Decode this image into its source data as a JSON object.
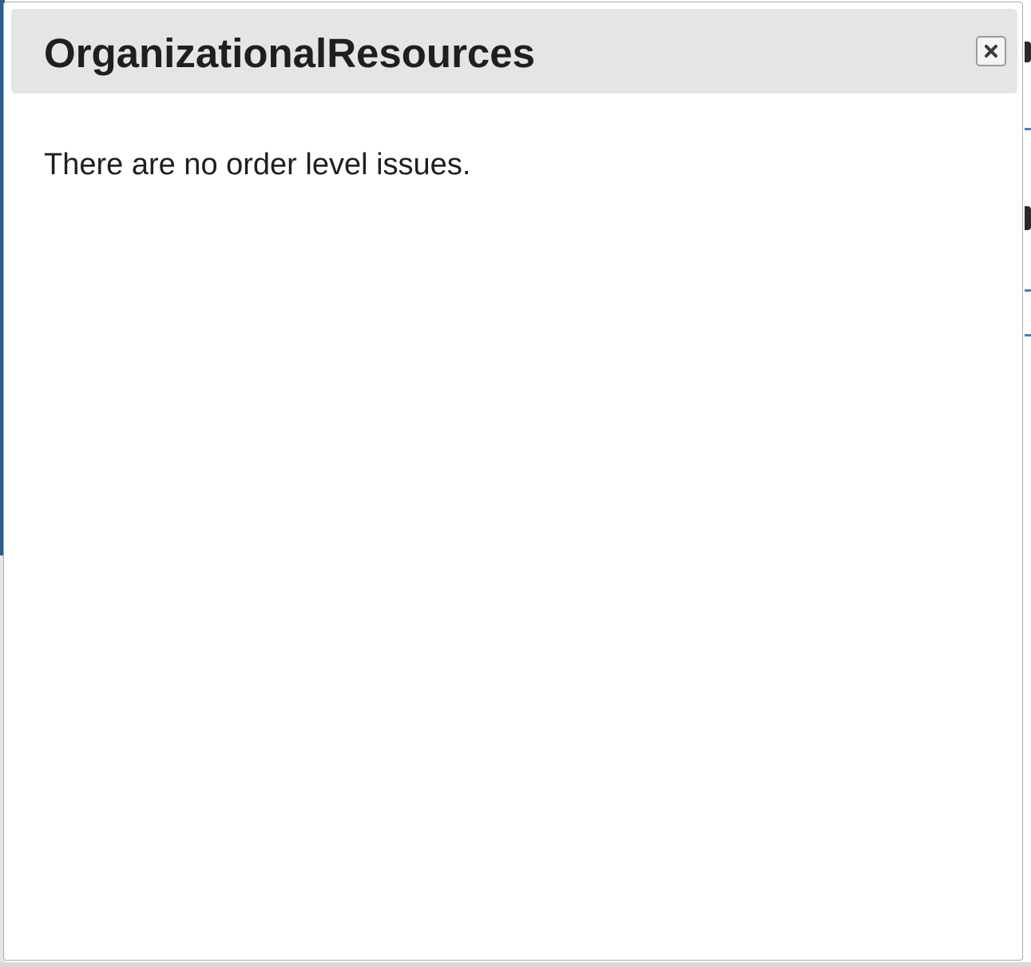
{
  "dialog": {
    "title": "OrganizationalResources",
    "close_icon": "close-icon",
    "message": "There are no order level issues."
  },
  "colors": {
    "titlebar_background": "#e6e5e4",
    "text": "#1f1f1f",
    "backdrop_accent": "#2f5d87"
  }
}
